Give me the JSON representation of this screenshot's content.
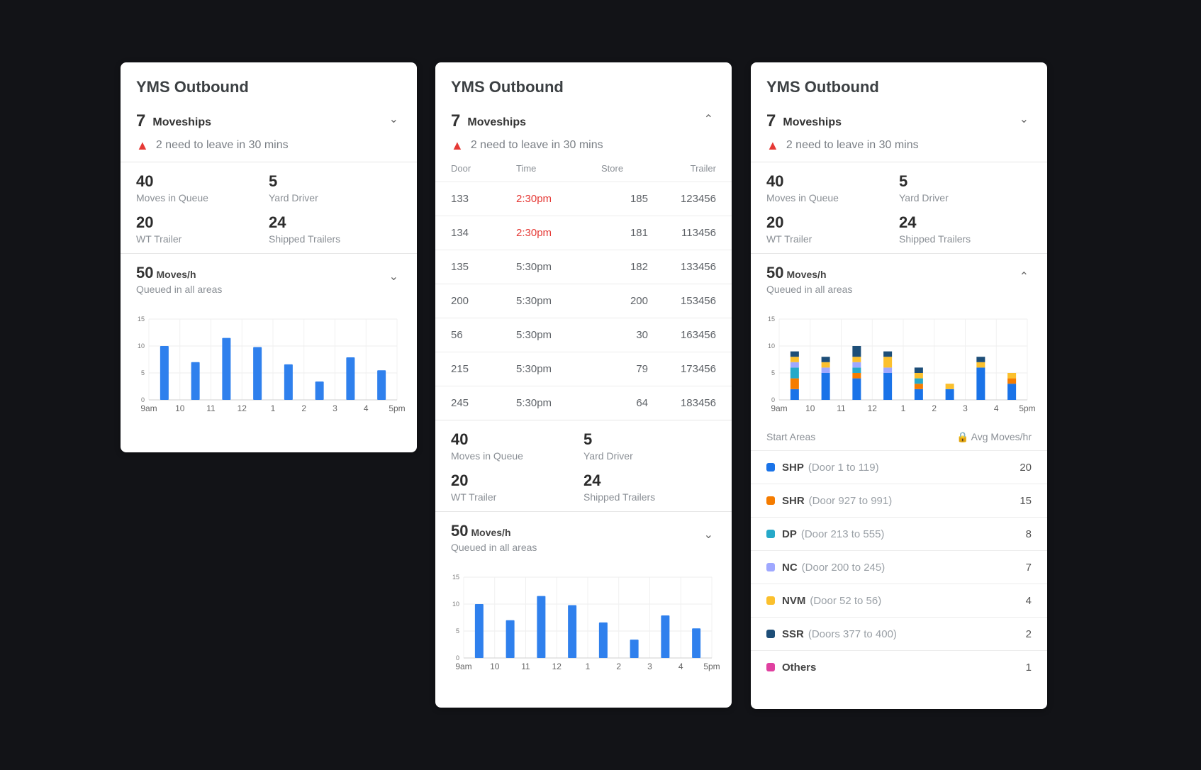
{
  "colors": {
    "bar": "#2f80ed",
    "alert": "#e53935",
    "background": "#121317",
    "series": [
      "#1a73e8",
      "#f57c00",
      "#26a9c9",
      "#9fa8ff",
      "#fbc02d",
      "#1d4e78",
      "#e040a0"
    ]
  },
  "card": {
    "title": "YMS Outbound",
    "moveships_count": "7",
    "moveships_label": "Moveships",
    "alert_text": "2 need to leave in 30 mins",
    "stats": [
      {
        "num": "40",
        "label": "Moves in Queue"
      },
      {
        "num": "5",
        "label": "Yard Driver"
      },
      {
        "num": "20",
        "label": "WT Trailer"
      },
      {
        "num": "24",
        "label": "Shipped Trailers"
      }
    ],
    "moves": {
      "num": "50",
      "unit": "Moves/h",
      "sub": "Queued in all areas"
    }
  },
  "table": {
    "headers": [
      "Door",
      "Time",
      "Store",
      "Trailer"
    ],
    "rows": [
      {
        "door": "133",
        "time": "2:30pm",
        "store": "185",
        "trailer": "123456",
        "late": true
      },
      {
        "door": "134",
        "time": "2:30pm",
        "store": "181",
        "trailer": "113456",
        "late": true
      },
      {
        "door": "135",
        "time": "5:30pm",
        "store": "182",
        "trailer": "133456",
        "late": false
      },
      {
        "door": "200",
        "time": "5:30pm",
        "store": "200",
        "trailer": "153456",
        "late": false
      },
      {
        "door": "56",
        "time": "5:30pm",
        "store": "30",
        "trailer": "163456",
        "late": false
      },
      {
        "door": "215",
        "time": "5:30pm",
        "store": "79",
        "trailer": "173456",
        "late": false
      },
      {
        "door": "245",
        "time": "5:30pm",
        "store": "64",
        "trailer": "183456",
        "late": false
      }
    ]
  },
  "legend": {
    "left_label": "Start Areas",
    "right_label": "Avg Moves/hr",
    "items": [
      {
        "name": "SHP",
        "range": "(Door 1 to 119)",
        "value": "20"
      },
      {
        "name": "SHR",
        "range": "(Door 927 to 991)",
        "value": "15"
      },
      {
        "name": "DP",
        "range": "(Door 213 to 555)",
        "value": "8"
      },
      {
        "name": "NC",
        "range": "(Door 200 to 245)",
        "value": "7"
      },
      {
        "name": "NVM",
        "range": "(Door 52 to 56)",
        "value": "4"
      },
      {
        "name": "SSR",
        "range": "(Doors 377 to 400)",
        "value": "2"
      },
      {
        "name": "Others",
        "range": "",
        "value": "1"
      }
    ]
  },
  "chart_data": [
    {
      "type": "bar",
      "title": "",
      "categories": [
        "9am",
        "10",
        "11",
        "12",
        "1",
        "2",
        "3",
        "4",
        "5pm"
      ],
      "yticks": [
        "15",
        "10",
        "5",
        "0"
      ],
      "ylim": [
        0,
        15
      ],
      "values": [
        10,
        7,
        11.5,
        9.8,
        6.6,
        3.4,
        7.9,
        5.5
      ],
      "grid": true
    },
    {
      "type": "bar",
      "title": "",
      "categories": [
        "9am",
        "10",
        "11",
        "12",
        "1",
        "2",
        "3",
        "4",
        "5pm"
      ],
      "yticks": [
        "15",
        "10",
        "5",
        "0"
      ],
      "ylim": [
        0,
        15
      ],
      "values": [
        10,
        7,
        11.5,
        9.8,
        6.6,
        3.4,
        7.9,
        5.5
      ],
      "grid": true
    },
    {
      "type": "bar",
      "title": "",
      "stacked": true,
      "categories": [
        "9am",
        "10",
        "11",
        "12",
        "1",
        "2",
        "3",
        "4",
        "5pm"
      ],
      "yticks": [
        "15",
        "10",
        "5",
        "0"
      ],
      "ylim": [
        0,
        15
      ],
      "series": [
        {
          "name": "SHP",
          "values": [
            2,
            5,
            4,
            5,
            2,
            2,
            6,
            3
          ]
        },
        {
          "name": "SHR",
          "values": [
            2,
            0,
            1,
            0,
            1,
            0,
            0,
            1
          ]
        },
        {
          "name": "DP",
          "values": [
            2,
            0,
            1,
            0,
            1,
            0,
            0,
            0
          ]
        },
        {
          "name": "NC",
          "values": [
            1,
            1,
            1,
            1,
            0,
            0,
            0,
            0
          ]
        },
        {
          "name": "NVM",
          "values": [
            1,
            1,
            1,
            2,
            1,
            1,
            1,
            1
          ]
        },
        {
          "name": "SSR",
          "values": [
            1,
            1,
            2,
            1,
            1,
            0,
            1,
            0
          ]
        },
        {
          "name": "Others",
          "values": [
            0,
            0,
            0,
            0,
            0,
            0,
            0,
            0
          ]
        }
      ],
      "grid": true
    }
  ]
}
